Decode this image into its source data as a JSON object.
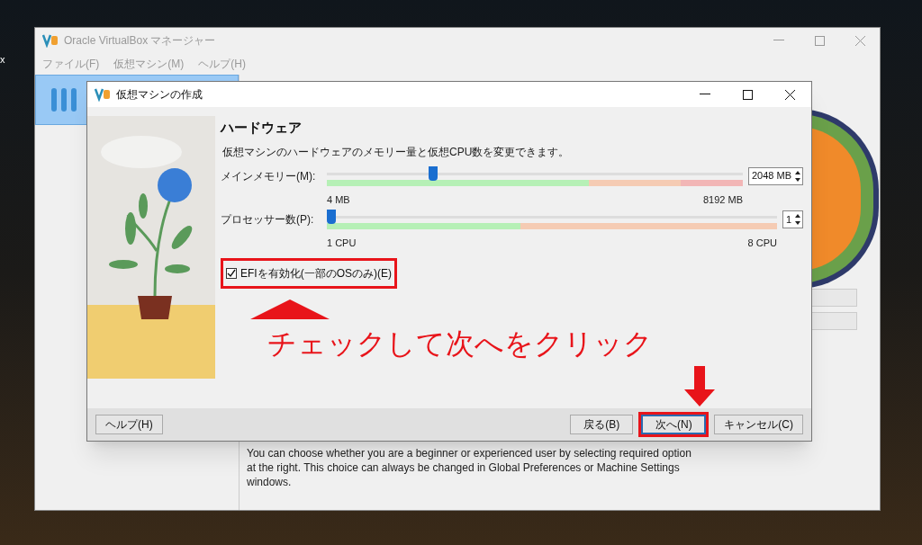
{
  "desktop": {
    "label": "x"
  },
  "main_window": {
    "title": "Oracle VirtualBox マネージャー",
    "menu": [
      "ファイル(F)",
      "仮想マシン(M)",
      "ヘルプ(H)"
    ],
    "description": "You can choose whether you are a beginner or experienced user by selecting required option at the right. This choice can always be changed in Global Preferences or Machine Settings windows."
  },
  "dialog": {
    "title": "仮想マシンの作成",
    "heading": "ハードウェア",
    "description": "仮想マシンのハードウェアのメモリー量と仮想CPU数を変更できます。",
    "sliders": [
      {
        "label": "メインメモリー(M):",
        "level": 0.25,
        "value": "2048 MB",
        "min": "4 MB",
        "max": "8192 MB"
      },
      {
        "label": "プロセッサー数(P):",
        "level": 0,
        "value": "1",
        "min": "1 CPU",
        "max": "8 CPU"
      }
    ],
    "efi": {
      "label": "EFIを有効化(一部のOSのみ)(E)",
      "checked": true
    },
    "buttons": [
      {
        "label": "ヘルプ(H)",
        "kind": "help",
        "selected": false
      },
      {
        "label": "戻る(B)",
        "kind": "nav",
        "selected": false
      },
      {
        "label": "次へ(N)",
        "kind": "nav",
        "selected": true
      },
      {
        "label": "キャンセル(C)",
        "kind": "nav",
        "selected": false
      }
    ]
  },
  "annotation": {
    "text": "チェックして次へをクリック"
  }
}
